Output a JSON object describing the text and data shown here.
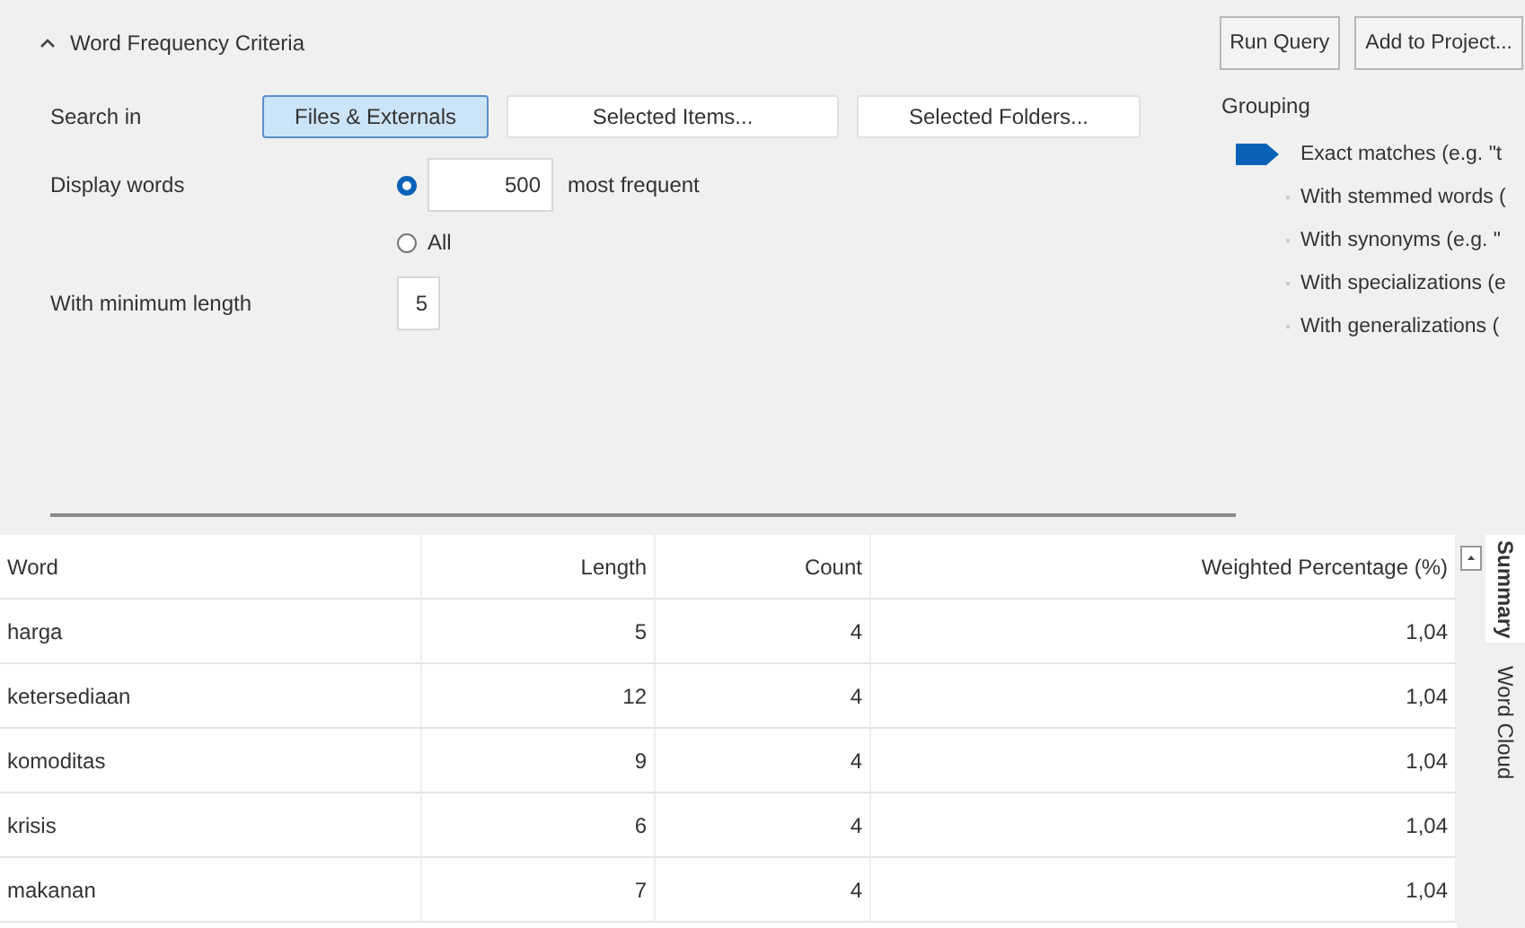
{
  "criteria": {
    "title": "Word Frequency Criteria",
    "expanded": true,
    "actions": [
      "Run Query",
      "Add to Project..."
    ],
    "search_in": {
      "label": "Search in",
      "options": [
        {
          "label": "Files & Externals",
          "selected": true
        },
        {
          "label": "Selected Items...",
          "selected": false
        },
        {
          "label": "Selected Folders...",
          "selected": false
        }
      ]
    },
    "display_words": {
      "label": "Display words",
      "options": [
        {
          "kind": "count",
          "value": "500",
          "suffix": "most frequent",
          "selected": true
        },
        {
          "kind": "all",
          "label": "All",
          "selected": false
        }
      ]
    },
    "min_length": {
      "label": "With minimum length",
      "value": "5"
    },
    "grouping": {
      "label": "Grouping",
      "items": [
        {
          "label": "Exact matches (e.g. \"t",
          "selected": true
        },
        {
          "label": "With stemmed words (",
          "selected": false
        },
        {
          "label": "With synonyms (e.g. \"",
          "selected": false
        },
        {
          "label": "With specializations (e",
          "selected": false
        },
        {
          "label": "With generalizations (",
          "selected": false
        }
      ]
    }
  },
  "table": {
    "columns": [
      "Word",
      "Length",
      "Count",
      "Weighted Percentage (%)"
    ],
    "rows": [
      [
        "harga",
        "5",
        "4",
        "1,04"
      ],
      [
        "ketersediaan",
        "12",
        "4",
        "1,04"
      ],
      [
        "komoditas",
        "9",
        "4",
        "1,04"
      ],
      [
        "krisis",
        "6",
        "4",
        "1,04"
      ],
      [
        "makanan",
        "7",
        "4",
        "1,04"
      ]
    ]
  },
  "side_tabs": [
    {
      "label": "Summary",
      "selected": true
    },
    {
      "label": "Word Cloud",
      "selected": false
    }
  ]
}
